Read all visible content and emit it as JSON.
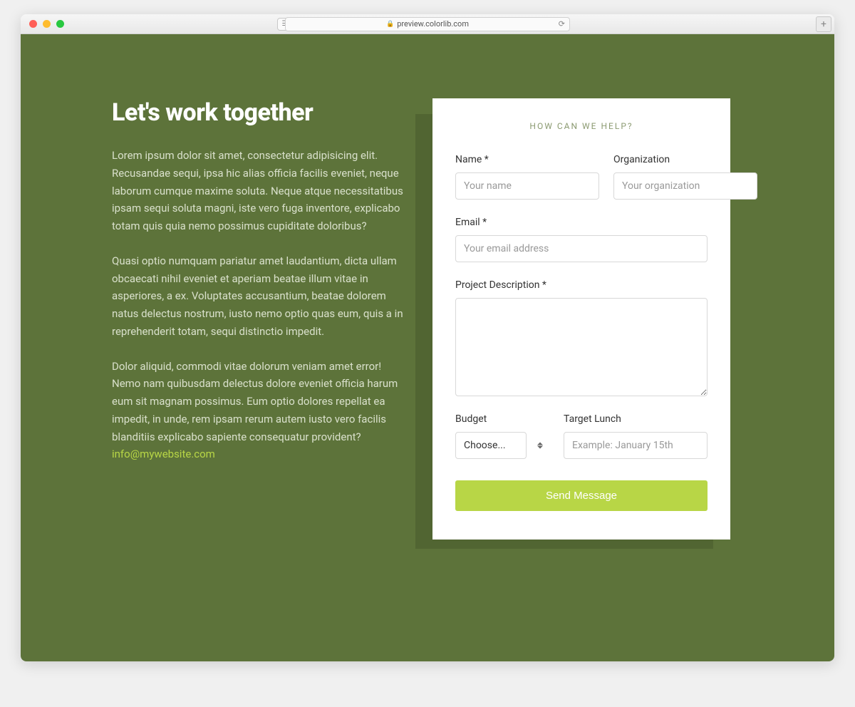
{
  "browser": {
    "url_host": "preview.colorlib.com"
  },
  "page": {
    "title": "Let's work together",
    "paragraphs": [
      "Lorem ipsum dolor sit amet, consectetur adipisicing elit. Recusandae sequi, ipsa hic alias officia facilis eveniet, neque laborum cumque maxime soluta. Neque atque necessitatibus ipsam sequi soluta magni, iste vero fuga inventore, explicabo totam quis quia nemo possimus cupiditate doloribus?",
      "Quasi optio numquam pariatur amet laudantium, dicta ullam obcaecati nihil eveniet et aperiam beatae illum vitae in asperiores, a ex. Voluptates accusantium, beatae dolorem natus delectus nostrum, iusto nemo optio quas eum, quis a in reprehenderit totam, sequi distinctio impedit."
    ],
    "paragraph3_prefix": "Dolor aliquid, commodi vitae dolorum veniam amet error! Nemo nam quibusdam delectus dolore eveniet officia harum eum sit magnam possimus. Eum optio dolores repellat ea impedit, in unde, rem ipsam rerum autem iusto vero facilis blanditiis explicabo sapiente consequatur provident? ",
    "email_link": "info@mywebsite.com"
  },
  "form": {
    "heading": "HOW CAN WE HELP?",
    "name_label": "Name *",
    "name_placeholder": "Your name",
    "org_label": "Organization",
    "org_placeholder": "Your organization",
    "email_label": "Email *",
    "email_placeholder": "Your email address",
    "desc_label": "Project Description *",
    "budget_label": "Budget",
    "budget_selected": "Choose...",
    "target_label": "Target Lunch",
    "target_placeholder": "Example: January 15th",
    "submit_label": "Send Message"
  }
}
